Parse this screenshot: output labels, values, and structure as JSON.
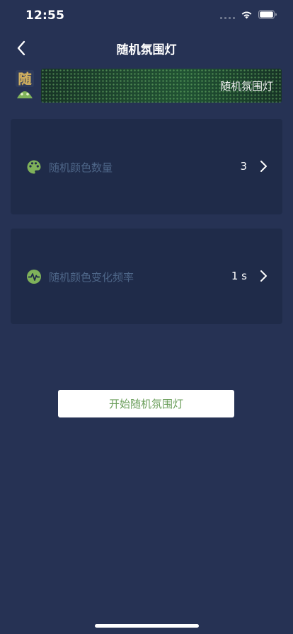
{
  "status_bar": {
    "time": "12:55"
  },
  "header": {
    "title": "随机氛围灯"
  },
  "banner": {
    "mascot_char": "随",
    "title": "随机氛围灯"
  },
  "settings": [
    {
      "label": "随机颜色数量",
      "value": "3",
      "icon": "palette-icon"
    },
    {
      "label": "随机颜色变化频率",
      "value": "1 s",
      "icon": "pulse-icon"
    }
  ],
  "start_button": {
    "label": "开始随机氛围灯"
  },
  "colors": {
    "background": "#263254",
    "card": "#1f2b49",
    "accent_green": "#6a9e5a",
    "muted_label": "#4e6688"
  }
}
